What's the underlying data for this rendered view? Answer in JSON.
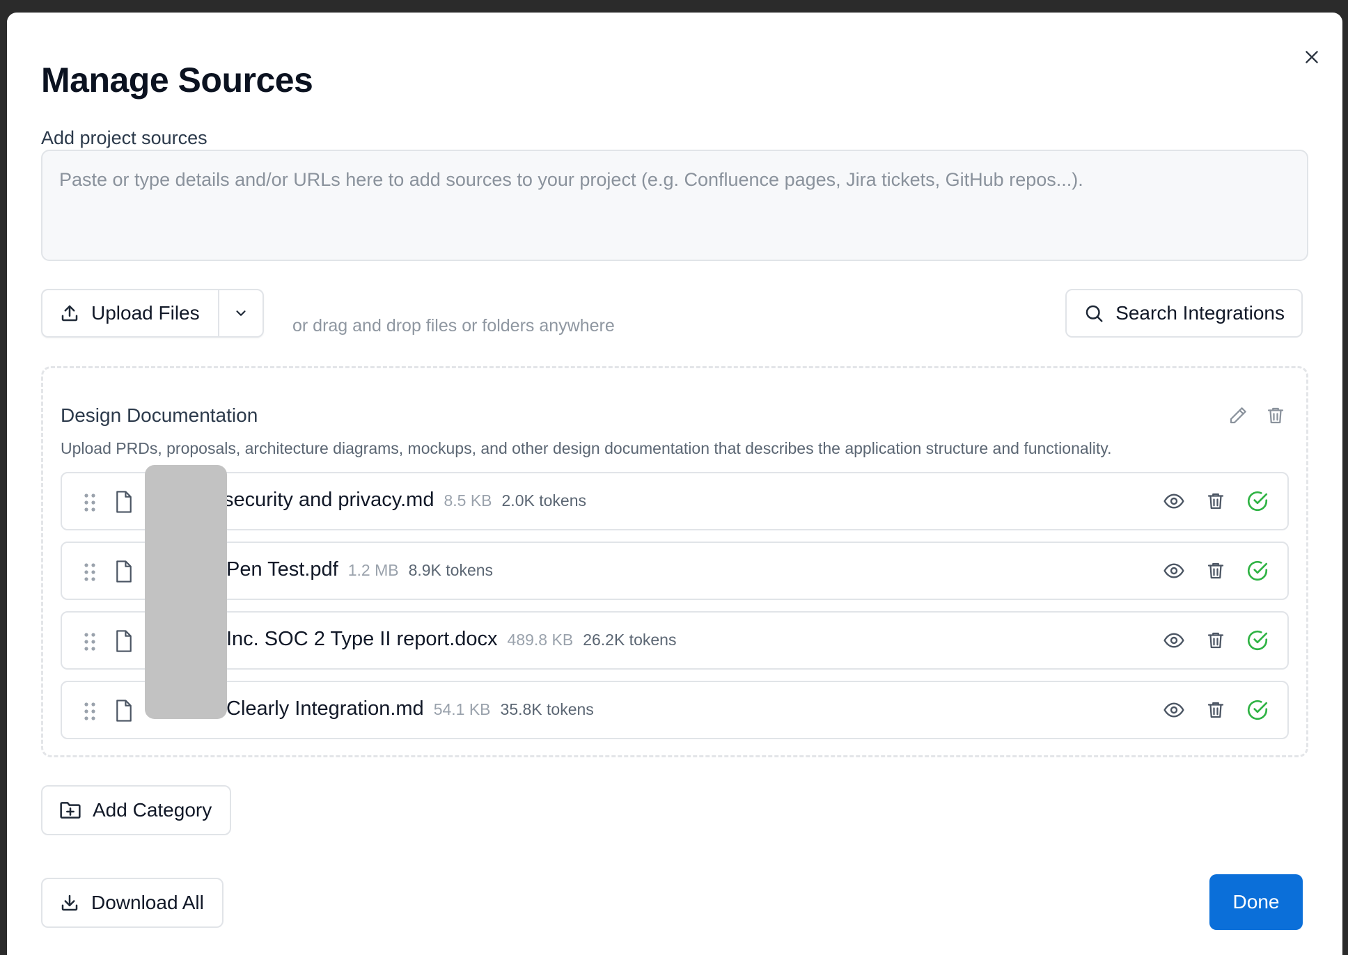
{
  "modal": {
    "title": "Manage Sources",
    "close_icon": "close-icon"
  },
  "sources_input": {
    "label": "Add project sources",
    "placeholder": "Paste or type details and/or URLs here to add sources to your project (e.g. Confluence pages, Jira tickets, GitHub repos...).",
    "value": ""
  },
  "toolbar": {
    "upload_label": "Upload Files",
    "upload_icon": "upload-icon",
    "dropdown_icon": "chevron-down-icon",
    "drag_hint": "or drag and drop files or folders anywhere",
    "search_label": "Search Integrations",
    "search_icon": "search-icon"
  },
  "category": {
    "title": "Design Documentation",
    "description": "Upload PRDs, proposals, architecture diagrams, mockups, and other design documentation that describes the application structure and functionality.",
    "files": [
      {
        "name": "security and privacy.md",
        "size": "8.5 KB",
        "tokens": "2.0K tokens",
        "status": "processed"
      },
      {
        "name": "Pen Test.pdf",
        "size": "1.2 MB",
        "tokens": "8.9K tokens",
        "status": "processed"
      },
      {
        "name": "Inc. SOC 2 Type II report.docx",
        "size": "489.8 KB",
        "tokens": "26.2K tokens",
        "status": "processed"
      },
      {
        "name": "Clearly Integration.md",
        "size": "54.1 KB",
        "tokens": "35.8K tokens",
        "status": "processed"
      }
    ]
  },
  "footer": {
    "add_category_label": "Add Category",
    "download_all_label": "Download All",
    "done_label": "Done"
  },
  "colors": {
    "primary": "#0b6fd9",
    "success": "#2fb344",
    "border": "#e1e4e8",
    "muted_text": "#8f97a1"
  }
}
